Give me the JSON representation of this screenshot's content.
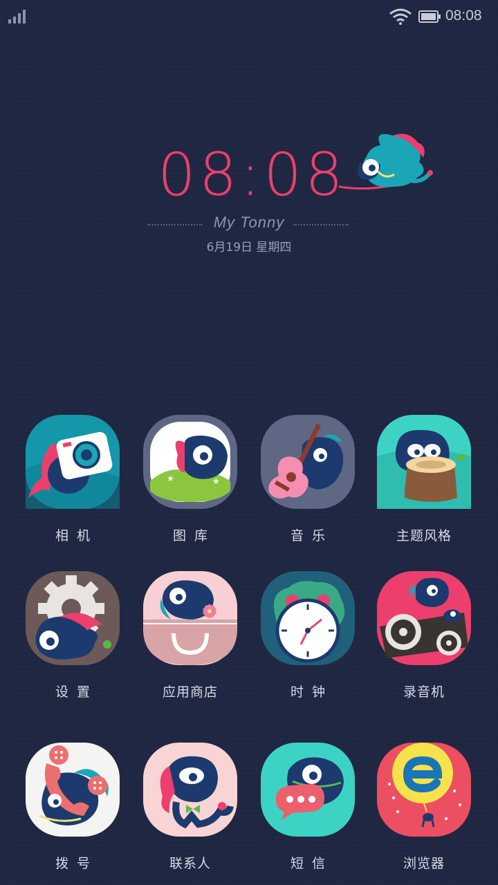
{
  "status_bar": {
    "time": "08:08",
    "signal_icon": "signal-icon",
    "wifi_icon": "wifi-icon",
    "battery_icon": "battery-icon"
  },
  "clock_widget": {
    "time": "08:08",
    "owner_name": "My Tonny",
    "date": "6月19日  星期四"
  },
  "colors": {
    "background": "#1e2540",
    "accent": "#ec3f6d",
    "teal": "#1aa6b7",
    "navy": "#1c3a6e"
  },
  "apps": [
    {
      "id": "camera",
      "label": "相机",
      "icon": "camera-icon"
    },
    {
      "id": "gallery",
      "label": "图库",
      "icon": "gallery-icon"
    },
    {
      "id": "music",
      "label": "音乐",
      "icon": "music-icon"
    },
    {
      "id": "themes",
      "label": "主题风格",
      "icon": "theme-icon"
    },
    {
      "id": "settings",
      "label": "设置",
      "icon": "gear-icon"
    },
    {
      "id": "app-store",
      "label": "应用商店",
      "icon": "shopping-bag-icon"
    },
    {
      "id": "clock",
      "label": "时钟",
      "icon": "alarm-clock-icon"
    },
    {
      "id": "recorder",
      "label": "录音机",
      "icon": "tape-recorder-icon"
    },
    {
      "id": "dialer",
      "label": "拨号",
      "icon": "phone-icon"
    },
    {
      "id": "contacts",
      "label": "联系人",
      "icon": "contacts-icon"
    },
    {
      "id": "messages",
      "label": "短信",
      "icon": "message-bubble-icon"
    },
    {
      "id": "browser",
      "label": "浏览器",
      "icon": "browser-icon"
    }
  ]
}
